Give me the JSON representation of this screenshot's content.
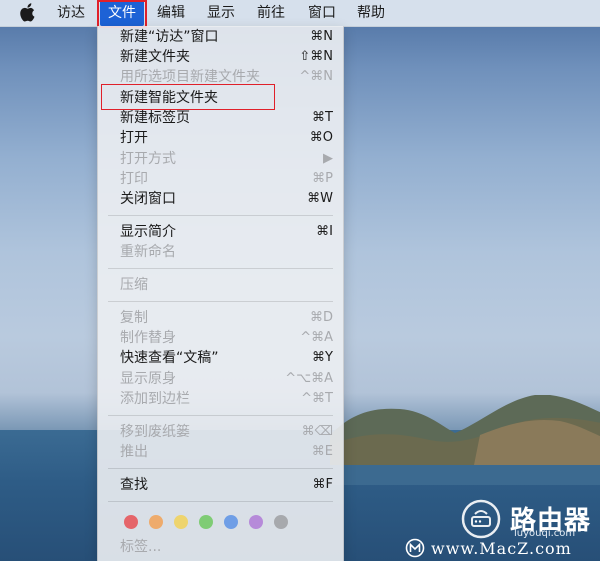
{
  "menubar": {
    "apple_icon": "apple-logo-icon",
    "items": [
      {
        "label": "访达"
      },
      {
        "label": "文件"
      },
      {
        "label": "编辑"
      },
      {
        "label": "显示"
      },
      {
        "label": "前往"
      },
      {
        "label": "窗口"
      },
      {
        "label": "帮助"
      }
    ]
  },
  "file_menu": {
    "items": [
      {
        "label": "新建“访达”窗口",
        "shortcut": "⌘N",
        "enabled": true
      },
      {
        "label": "新建文件夹",
        "shortcut": "⇧⌘N",
        "enabled": true
      },
      {
        "label": "用所选项目新建文件夹",
        "shortcut": "^⌘N",
        "enabled": false
      },
      {
        "label": "新建智能文件夹",
        "shortcut": "",
        "enabled": true
      },
      {
        "label": "新建标签页",
        "shortcut": "⌘T",
        "enabled": true
      },
      {
        "label": "打开",
        "shortcut": "⌘O",
        "enabled": true
      },
      {
        "label": "打开方式",
        "shortcut": "▶",
        "enabled": false
      },
      {
        "label": "打印",
        "shortcut": "⌘P",
        "enabled": false
      },
      {
        "label": "关闭窗口",
        "shortcut": "⌘W",
        "enabled": true
      },
      {
        "label": "显示简介",
        "shortcut": "⌘I",
        "enabled": true
      },
      {
        "label": "重新命名",
        "shortcut": "",
        "enabled": false
      },
      {
        "label": "压缩",
        "shortcut": "",
        "enabled": false
      },
      {
        "label": "复制",
        "shortcut": "⌘D",
        "enabled": false
      },
      {
        "label": "制作替身",
        "shortcut": "^⌘A",
        "enabled": false
      },
      {
        "label": "快速查看“文稿”",
        "shortcut": "⌘Y",
        "enabled": true
      },
      {
        "label": "显示原身",
        "shortcut": "^⌥⌘A",
        "enabled": false
      },
      {
        "label": "添加到边栏",
        "shortcut": "^⌘T",
        "enabled": false
      },
      {
        "label": "移到废纸篓",
        "shortcut": "⌘⌫",
        "enabled": false
      },
      {
        "label": "推出",
        "shortcut": "⌘E",
        "enabled": false
      },
      {
        "label": "查找",
        "shortcut": "⌘F",
        "enabled": true
      }
    ],
    "tag_colors": [
      "#e5656a",
      "#eeab6c",
      "#eed46e",
      "#7fcc75",
      "#6f9ee6",
      "#b68ad9",
      "#a7a9ad"
    ],
    "tags_label": "标签..."
  },
  "highlight_color": "#e0202a",
  "menubar_active_color": "#1d62d6",
  "watermark": {
    "brand_cn": "路由器",
    "brand_url": "luyouqi.com",
    "macz_text": "www.MacZ.com"
  }
}
